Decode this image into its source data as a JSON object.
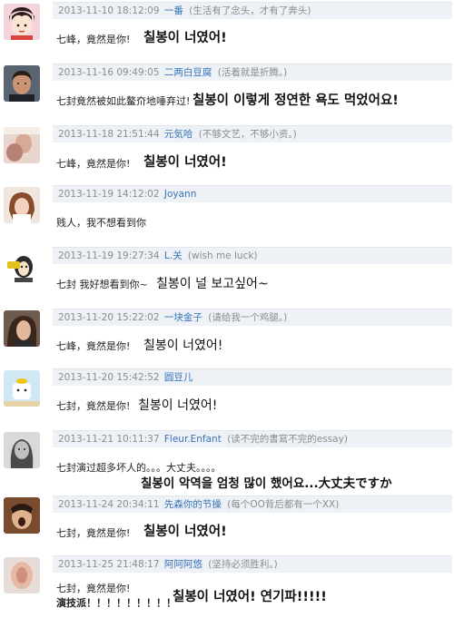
{
  "comments": [
    {
      "time": "2013-11-10 18:12:09",
      "user": "一番",
      "signature": "(生活有了念头，才有了奔头)",
      "comment": "七峰，竟然是你!",
      "translation": "칠봉이 너였어!"
    },
    {
      "time": "2013-11-16 09:49:05",
      "user": "二两白豆腐",
      "signature": "(活着就是折腾。)",
      "comment": "七封竟然被如此鳌夼地唾弃过!",
      "translation": "칠봉이 이렇게 정연한 욕도 먹었어요!"
    },
    {
      "time": "2013-11-18 21:51:44",
      "user": "元気哈",
      "signature": "(不够文艺，不够小资。)",
      "comment": "七峰，竟然是你!",
      "translation": "칠봉이 너였어!"
    },
    {
      "time": "2013-11-19 14:12:02",
      "user": "Joyann",
      "signature": "",
      "comment": "贱人，我不想看到你",
      "translation": ""
    },
    {
      "time": "2013-11-19 19:27:34",
      "user": "L.关",
      "signature": "(wish me luck)",
      "comment": "七封 我好想看到你~",
      "translation": "칠봉이 널 보고싶어~"
    },
    {
      "time": "2013-11-20 15:22:02",
      "user": "一块金子",
      "signature": "(请给我一个鸡腿。)",
      "comment": "七峰，竟然是你!",
      "translation": "칠봉이 너였어!"
    },
    {
      "time": "2013-11-20 15:42:52",
      "user": "圆豆儿",
      "signature": "",
      "comment": "七封，竟然是你!",
      "translation": "칠봉이 너였어!"
    },
    {
      "time": "2013-11-21 10:11:37",
      "user": "Fleur.Enfant",
      "signature": "(读不完的書寫不完的essay)",
      "comment": "七封演过超多坏人的。。。大丈夫。。。。",
      "translation": "칠봉이 악역을 엄청 많이 했어요...大丈夫ですか"
    },
    {
      "time": "2013-11-24 20:34:11",
      "user": "先森你的节操",
      "signature": "(每个OO背后都有一个XX)",
      "comment": "七封，竟然是你!",
      "translation": "칠봉이 너였어!"
    },
    {
      "time": "2013-11-25 21:48:17",
      "user": "阿阿阿悠",
      "signature": "(坚持必须胜利。)",
      "comment": "七封，竟然是你!",
      "comment2": "演技派！！！！！！！！！",
      "translation": "칠봉이 너였어! 연기파!!!!!"
    }
  ]
}
